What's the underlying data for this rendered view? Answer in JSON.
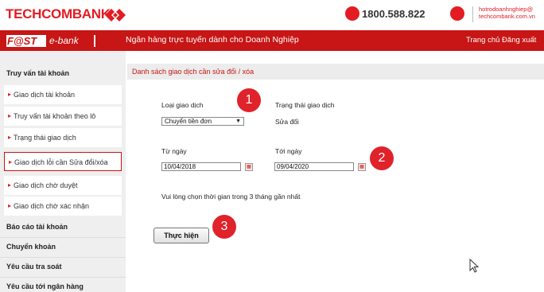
{
  "header": {
    "brand": "TECHCOMBANK",
    "hotline": "1800.588.822",
    "email_line1": "hotrodoanhnghiep@",
    "email_line2": "techcombank.com.vn"
  },
  "banner": {
    "logo_fast": "F@ST",
    "logo_ebank": "e-bank",
    "title": "Ngân hàng trực tuyến dành cho Doanh Nghiệp",
    "links": "Trang chủ  Đăng xuất"
  },
  "sidebar": {
    "section_inquiry": "Truy vấn tài khoản",
    "items": [
      "Giao dịch tài khoản",
      "Truy vấn tài khoản theo lô",
      "Trạng thái giao dịch",
      "Giao dịch lỗi cần Sửa đổi/xóa",
      "Giao dịch chờ duyệt",
      "Giao dịch chờ xác nhận"
    ],
    "sections": [
      "Báo cáo tài khoản",
      "Chuyển khoản",
      "Yêu cầu tra soát",
      "Yêu cầu tới ngân hàng"
    ]
  },
  "main": {
    "title": "Danh sách giao dịch cần sửa đổi / xóa",
    "type_label": "Loại giao dịch",
    "type_value": "Chuyển tiền đơn",
    "status_label": "Trạng thái giao dịch",
    "status_value": "Sửa đổi",
    "from_label": "Từ ngày",
    "from_value": "10/04/2018",
    "to_label": "Tới ngày",
    "to_value": "09/04/2020",
    "note": "Vui lòng chọn thời gian trong 3 tháng gần nhất",
    "submit": "Thực hiện"
  },
  "markers": [
    "1",
    "2",
    "3"
  ]
}
